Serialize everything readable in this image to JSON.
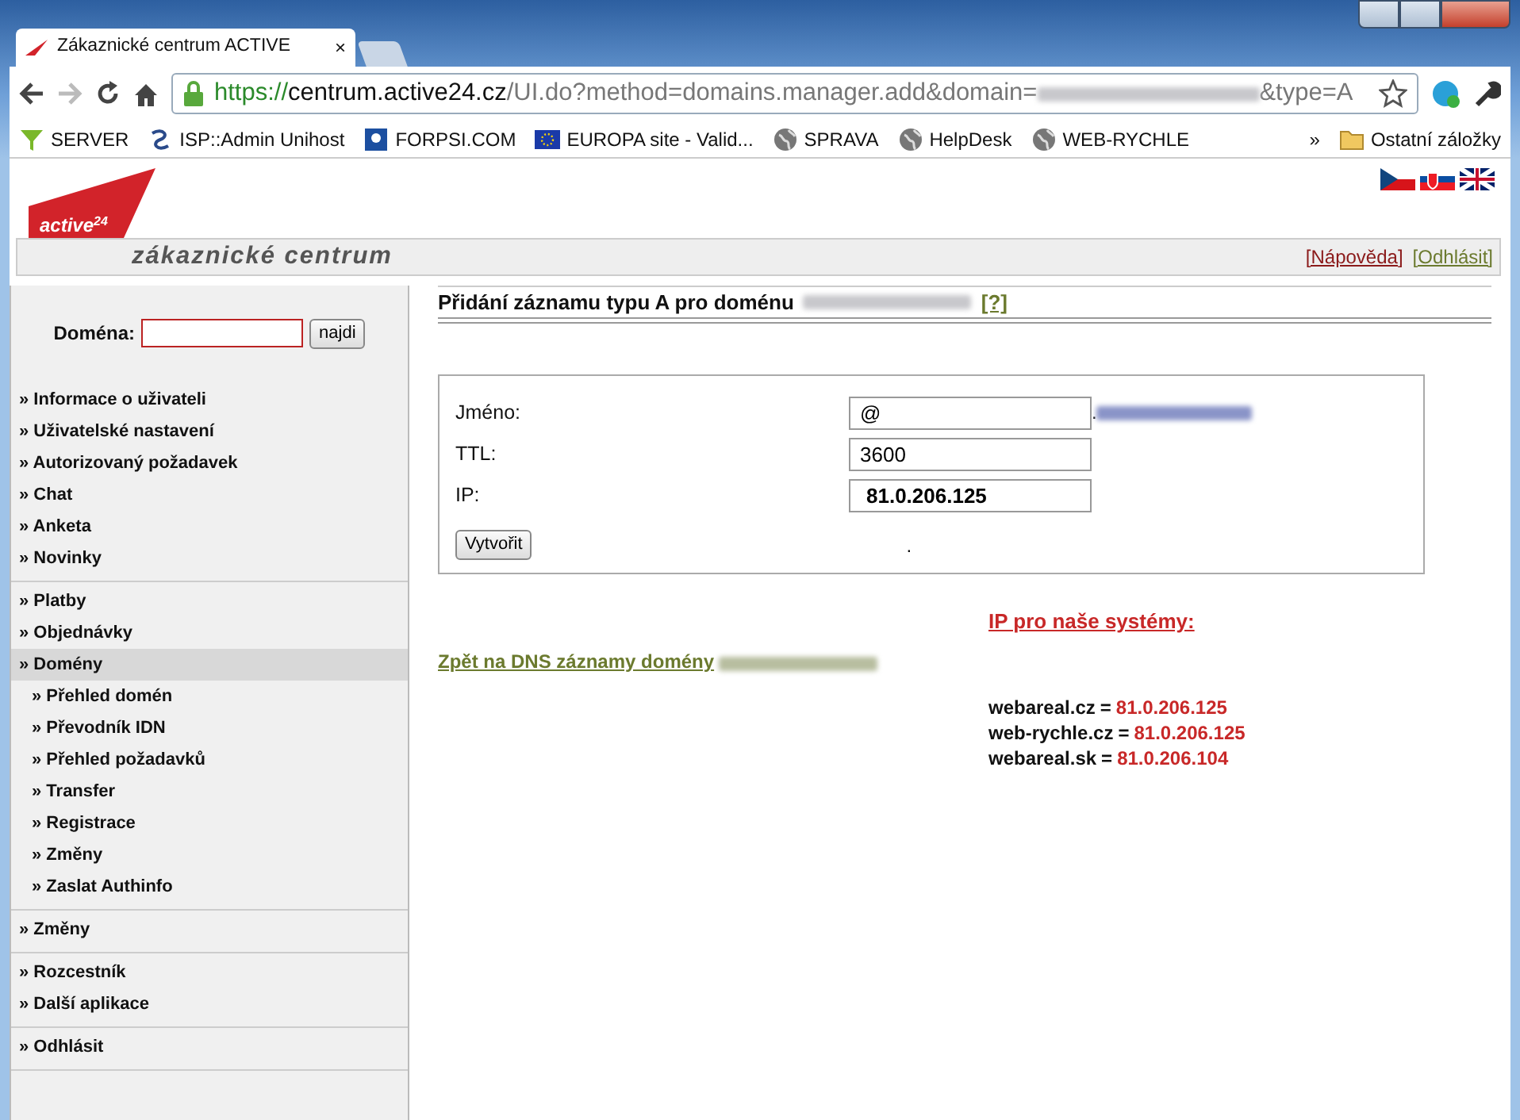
{
  "browser": {
    "tab_title": "Zákaznické centrum ACTIVE",
    "tab_close": "×",
    "url_scheme": "https://",
    "url_host": "centrum.active24.cz",
    "url_path": "/UI.do?method=domains.manager.add&domain=",
    "url_tail": "&type=A",
    "bookmarks": [
      {
        "label": "SERVER",
        "kind": "funnel"
      },
      {
        "label": "ISP::Admin Unihost",
        "kind": "swirl"
      },
      {
        "label": "FORPSI.COM",
        "kind": "square"
      },
      {
        "label": "EUROPA site - Valid...",
        "kind": "flag"
      },
      {
        "label": "SPRAVA",
        "kind": "globe"
      },
      {
        "label": "HelpDesk",
        "kind": "globe"
      },
      {
        "label": "WEB-RYCHLE",
        "kind": "globe"
      }
    ],
    "overflow": "»",
    "other_bookmarks": "Ostatní záložky"
  },
  "header": {
    "brand": "active",
    "brand_suffix": "24",
    "tagline": "zákaznické centrum",
    "links": [
      {
        "label": "[Nápověda]",
        "color": "#8b1a1a"
      },
      {
        "label": "[Odhlásit]",
        "color": "#6b7a2e"
      }
    ]
  },
  "sidebar": {
    "search": {
      "label": "Doména:",
      "button": "najdi"
    },
    "groups": [
      [
        {
          "label": "» Informace o uživateli",
          "selected": false
        },
        {
          "label": "» Uživatelské nastavení",
          "selected": false
        },
        {
          "label": "» Autorizovaný požadavek",
          "selected": false
        },
        {
          "label": "» Chat",
          "selected": false
        },
        {
          "label": "» Anketa",
          "selected": false
        },
        {
          "label": "» Novinky",
          "selected": false
        }
      ],
      [
        {
          "label": "» Platby",
          "selected": false
        },
        {
          "label": "» Objednávky",
          "selected": false
        },
        {
          "label": "» Domény",
          "selected": true,
          "children": [
            {
              "label": "» Přehled domén",
              "selected": false
            },
            {
              "label": "» Převodník IDN",
              "selected": false
            },
            {
              "label": "» Přehled požadavků",
              "selected": false
            },
            {
              "label": "» Transfer",
              "selected": false
            },
            {
              "label": "» Registrace",
              "selected": false
            },
            {
              "label": "» Změny",
              "selected": false
            },
            {
              "label": "» Zaslat Authinfo",
              "selected": false
            }
          ]
        }
      ],
      [
        {
          "label": "» Změny",
          "selected": false
        }
      ],
      [
        {
          "label": "» Rozcestník",
          "selected": false
        },
        {
          "label": "» Další aplikace",
          "selected": false
        }
      ],
      [
        {
          "label": "» Odhlásit",
          "selected": false
        }
      ]
    ]
  },
  "form": {
    "title": "Přidání záznamu typu A pro doménu",
    "help": "[?]",
    "fields": [
      {
        "label": "Jméno:",
        "value": "@",
        "suffix": "."
      },
      {
        "label": "TTL:",
        "value": "3600"
      },
      {
        "label": "IP:",
        "value": "81.0.206.125"
      }
    ],
    "button": "Vytvořit",
    "note": "."
  },
  "back_link": "Zpět na DNS záznamy domény",
  "ip_info": {
    "heading": "IP pro naše systémy:",
    "entries": [
      {
        "host": "webareal.cz",
        "sign": "=",
        "ip": "81.0.206.125"
      },
      {
        "host": "web-rychle.cz",
        "sign": "=",
        "ip": "81.0.206.125"
      },
      {
        "host": "webareal.sk",
        "sign": "=",
        "ip": "81.0.206.104"
      }
    ]
  }
}
